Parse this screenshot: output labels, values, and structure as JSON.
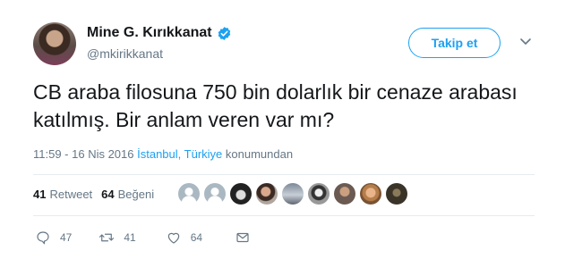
{
  "user": {
    "display_name": "Mine G. Kırıkkanat",
    "handle": "@mkirikkanat",
    "verified_icon": "verified-badge-icon",
    "avatar": "user-avatar"
  },
  "header": {
    "follow_label": "Takip et",
    "menu_icon": "chevron-down-icon"
  },
  "tweet": {
    "text": "CB araba filosuna 750 bin dolarlık bir cenaze arabası katılmış. Bir anlam veren var mı?",
    "time_date": "11:59 - 16 Nis 2016",
    "location": "İstanbul, Türkiye",
    "location_suffix": "konumundan"
  },
  "stats": {
    "retweet_count": "41",
    "retweet_label": "Retweet",
    "like_count": "64",
    "like_label": "Beğeni",
    "liker_avatars": 9
  },
  "actions": {
    "reply_count": "47",
    "retweet_count": "41",
    "like_count": "64"
  },
  "colors": {
    "accent": "#1da1f2",
    "muted": "#657786",
    "text": "#14171a",
    "divider": "#e6ecf0"
  }
}
